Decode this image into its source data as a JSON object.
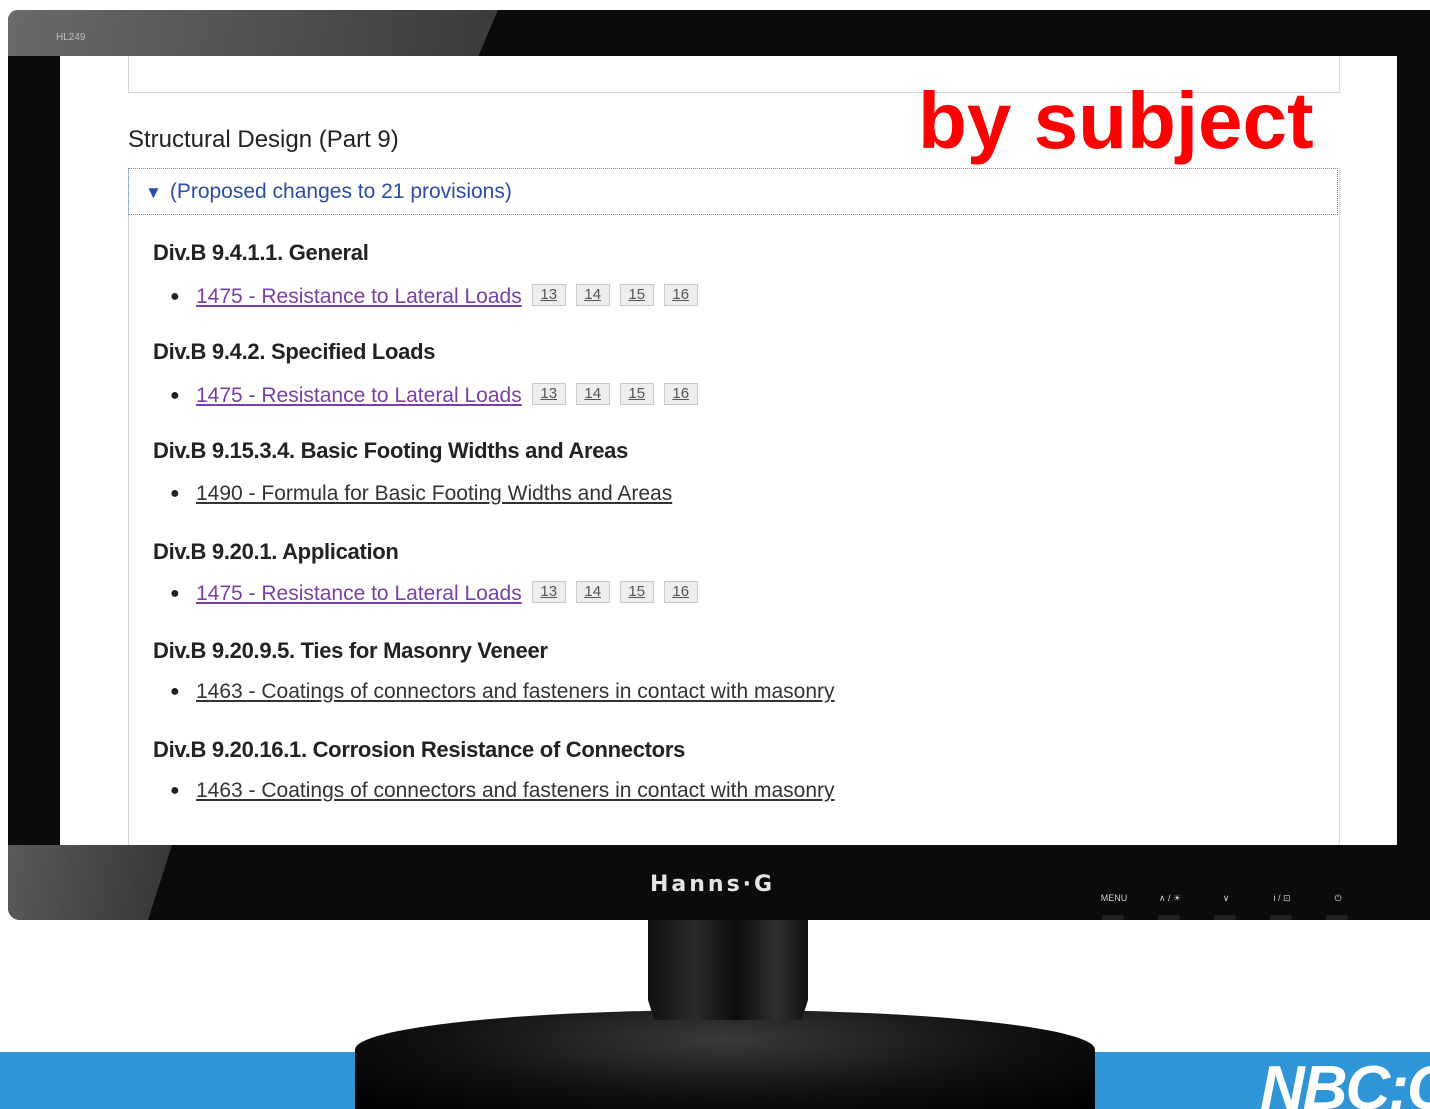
{
  "monitor": {
    "model_label": "HL249",
    "brand": "Hanns·G",
    "controls": [
      "MENU",
      "∧ / ☀",
      "∨",
      "i / ⊡",
      "⏻"
    ]
  },
  "overlay_text": "by subject",
  "footer_logo": "NBC:C",
  "page": {
    "section_title": "Structural Design (Part 9)",
    "summary_toggle": "▼",
    "summary_label": "(Proposed changes to 21 provisions)",
    "provisions": [
      {
        "heading": "Div.B 9.4.1.1. General",
        "item": "1475 - Resistance to Lateral Loads",
        "visited": true,
        "tags": [
          "13",
          "14",
          "15",
          "16"
        ]
      },
      {
        "heading": "Div.B 9.4.2. Specified Loads",
        "item": "1475 - Resistance to Lateral Loads",
        "visited": true,
        "tags": [
          "13",
          "14",
          "15",
          "16"
        ]
      },
      {
        "heading": "Div.B 9.15.3.4. Basic Footing Widths and Areas",
        "item": "1490 - Formula for Basic Footing Widths and Areas",
        "visited": false,
        "tags": []
      },
      {
        "heading": "Div.B 9.20.1. Application",
        "item": "1475 - Resistance to Lateral Loads",
        "visited": true,
        "tags": [
          "13",
          "14",
          "15",
          "16"
        ]
      },
      {
        "heading": "Div.B 9.20.9.5. Ties for Masonry Veneer",
        "item": "1463 - Coatings of connectors and fasteners in contact with masonry",
        "visited": false,
        "tags": []
      },
      {
        "heading": "Div.B 9.20.16.1. Corrosion Resistance of Connectors",
        "item": "1463 - Coatings of connectors and fasteners in contact with masonry",
        "visited": false,
        "tags": []
      }
    ]
  },
  "colors": {
    "overlay": "#ff0000",
    "visited_link": "#7a3fa6",
    "summary_text": "#2a4ea8",
    "band": "#2f95d6"
  }
}
